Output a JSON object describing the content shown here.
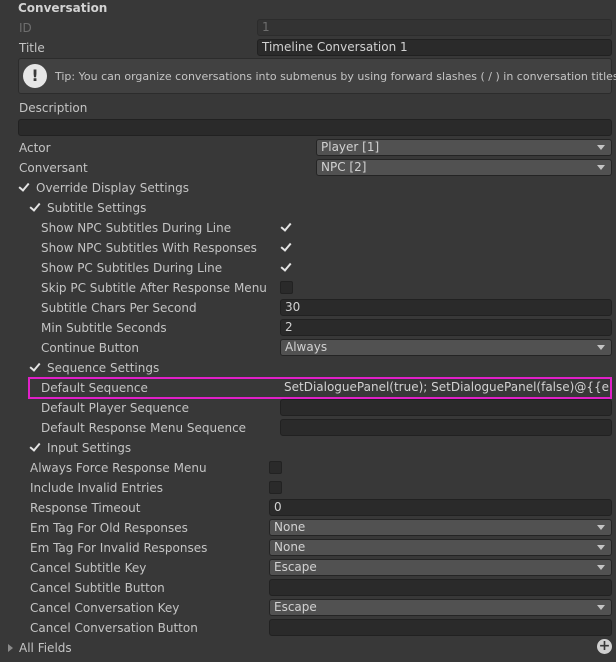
{
  "header": {
    "title": "Conversation"
  },
  "fields": {
    "id": {
      "label": "ID",
      "value": "1"
    },
    "title": {
      "label": "Title",
      "value": "Timeline Conversation 1"
    },
    "tip": {
      "icon": "!",
      "text": "Tip: You can organize conversations into submenus by using forward slashes ( / ) in conversation titles."
    },
    "description": {
      "label": "Description",
      "value": ""
    },
    "actor": {
      "label": "Actor",
      "value": "Player [1]"
    },
    "conversant": {
      "label": "Conversant",
      "value": "NPC [2]"
    }
  },
  "override_display": {
    "label": "Override Display Settings",
    "checked": true
  },
  "subtitle_settings": {
    "label": "Subtitle Settings",
    "checked": true,
    "show_npc_during_line": {
      "label": "Show NPC Subtitles During Line",
      "checked": true
    },
    "show_npc_with_responses": {
      "label": "Show NPC Subtitles With Responses",
      "checked": true
    },
    "show_pc_during_line": {
      "label": "Show PC Subtitles During Line",
      "checked": true
    },
    "skip_pc_after_response": {
      "label": "Skip PC Subtitle After Response Menu",
      "checked": false
    },
    "chars_per_second": {
      "label": "Subtitle Chars Per Second",
      "value": "30"
    },
    "min_seconds": {
      "label": "Min Subtitle Seconds",
      "value": "2"
    },
    "continue_button": {
      "label": "Continue Button",
      "value": "Always"
    }
  },
  "sequence_settings": {
    "label": "Sequence Settings",
    "checked": true,
    "default_sequence": {
      "label": "Default Sequence",
      "value": "SetDialoguePanel(true); SetDialoguePanel(false)@{{end}}"
    },
    "default_player_sequence": {
      "label": "Default Player Sequence",
      "value": ""
    },
    "default_response_menu_sequence": {
      "label": "Default Response Menu Sequence",
      "value": ""
    }
  },
  "input_settings": {
    "label": "Input Settings",
    "checked": true,
    "always_force_response_menu": {
      "label": "Always Force Response Menu",
      "checked": false
    },
    "include_invalid_entries": {
      "label": "Include Invalid Entries",
      "checked": false
    },
    "response_timeout": {
      "label": "Response Timeout",
      "value": "0"
    },
    "em_tag_old": {
      "label": "Em Tag For Old Responses",
      "value": "None"
    },
    "em_tag_invalid": {
      "label": "Em Tag For Invalid Responses",
      "value": "None"
    },
    "cancel_subtitle_key": {
      "label": "Cancel Subtitle Key",
      "value": "Escape"
    },
    "cancel_subtitle_button": {
      "label": "Cancel Subtitle Button",
      "value": ""
    },
    "cancel_conversation_key": {
      "label": "Cancel Conversation Key",
      "value": "Escape"
    },
    "cancel_conversation_button": {
      "label": "Cancel Conversation Button",
      "value": ""
    }
  },
  "all_fields": {
    "label": "All Fields",
    "add_icon": "+"
  }
}
